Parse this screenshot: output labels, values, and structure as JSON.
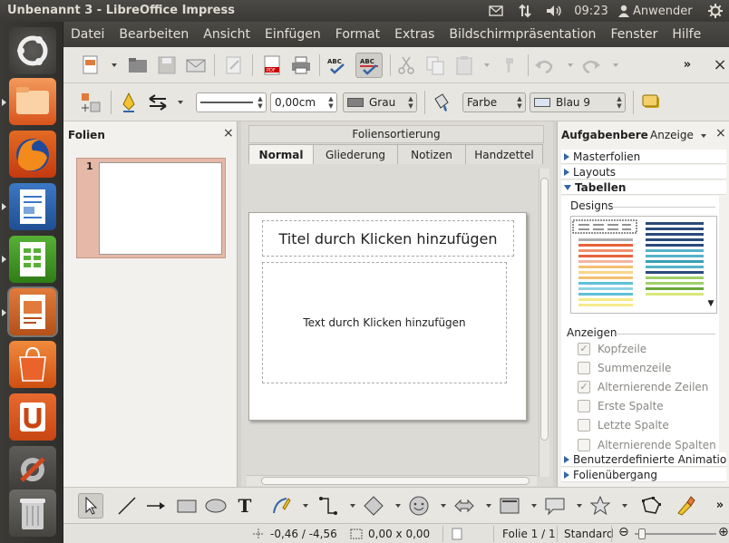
{
  "window": {
    "title": "Unbenannt 3 - LibreOffice Impress"
  },
  "tray": {
    "time": "09:23",
    "user": "Anwender"
  },
  "launcher": {
    "items": [
      "ubuntu-dash",
      "files",
      "firefox",
      "writer",
      "calc",
      "impress",
      "software-center",
      "ubuntu-one",
      "system-settings",
      "trash"
    ]
  },
  "menu": {
    "items": [
      "Datei",
      "Bearbeiten",
      "Ansicht",
      "Einfügen",
      "Format",
      "Extras",
      "Bildschirmpräsentation",
      "Fenster",
      "Hilfe"
    ]
  },
  "line_toolbar": {
    "line_width": "0,00cm",
    "line_color": "Grau",
    "area_style": "Farbe",
    "area_color": "Blau 9"
  },
  "slides_panel": {
    "title": "Folien",
    "slide_number": "1"
  },
  "center": {
    "sorter_title": "Foliensortierung",
    "tabs": [
      "Normal",
      "Gliederung",
      "Notizen",
      "Handzettel"
    ],
    "title_placeholder": "Titel durch Klicken hinzufügen",
    "text_placeholder": "Text durch Klicken hinzufügen"
  },
  "task_pane": {
    "title": "Aufgabenbereich",
    "view_label": "Anzeige",
    "sections": [
      "Masterfolien",
      "Layouts",
      "Tabellen"
    ],
    "designs_label": "Designs",
    "anzeigen_label": "Anzeigen",
    "options": [
      {
        "label": "Kopfzeile",
        "checked": true
      },
      {
        "label": "Summenzeile",
        "checked": false
      },
      {
        "label": "Alternierende Zeilen",
        "checked": true
      },
      {
        "label": "Erste Spalte",
        "checked": false
      },
      {
        "label": "Letzte Spalte",
        "checked": false
      },
      {
        "label": "Alternierende Spalten",
        "checked": false
      }
    ],
    "bottom_sections": [
      "Benutzerdefinierte Animation",
      "Folienübergang"
    ]
  },
  "status": {
    "position": "-0,46 / -4,56",
    "size": "0,00 x 0,00",
    "slide": "Folie 1 / 1",
    "layout": "Standard"
  },
  "colors": {
    "accent": "#3465a4",
    "panel_bg": "#f2f1ed",
    "slide_thumb_bg": "#e6b8a8"
  }
}
